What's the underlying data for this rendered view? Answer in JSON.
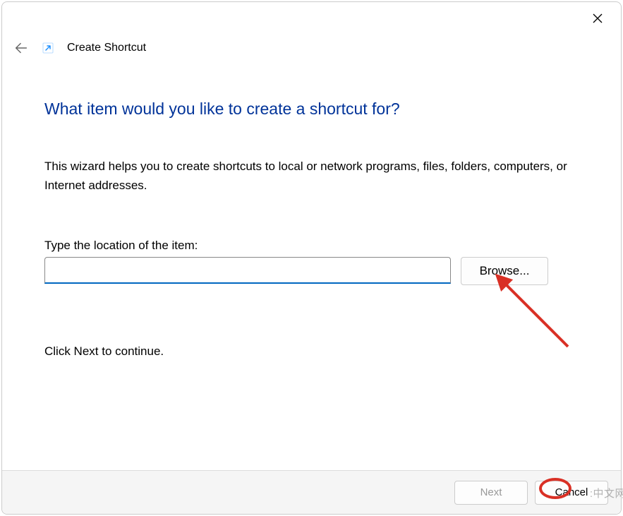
{
  "window": {
    "title": "Create Shortcut"
  },
  "heading": "What item would you like to create a shortcut for?",
  "description": "This wizard helps you to create shortcuts to local or network programs, files, folders, computers, or Internet addresses.",
  "field": {
    "label": "Type the location of the item:",
    "value": ""
  },
  "browse_label": "Browse...",
  "continue_text": "Click Next to continue.",
  "footer": {
    "next_label": "Next",
    "cancel_label": "Cancel"
  },
  "watermark": ":中文网",
  "annotation_color": "#d93025"
}
